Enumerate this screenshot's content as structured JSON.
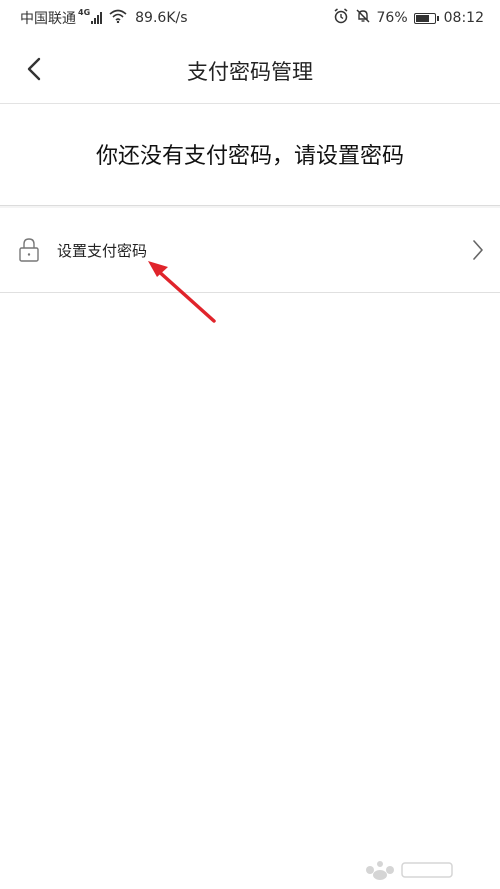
{
  "status_bar": {
    "carrier": "中国联通",
    "network_type": "4G",
    "speed": "89.6K/s",
    "battery_percent": "76%",
    "battery_level": 0.76,
    "time": "08:12",
    "icons": [
      "signal-icon",
      "wifi-icon",
      "alarm-icon",
      "mute-bell-icon",
      "battery-icon"
    ]
  },
  "header": {
    "title": "支付密码管理",
    "back_icon": "chevron-left-icon"
  },
  "notice": {
    "text": "你还没有支付密码，请设置密码"
  },
  "menu": {
    "items": [
      {
        "label": "设置支付密码",
        "icon": "lock-icon",
        "trailing_icon": "chevron-right-icon"
      }
    ]
  },
  "annotation": {
    "arrow_color": "#e0242b"
  },
  "colors": {
    "background": "#ffffff",
    "divider": "#e0e0e0",
    "text_primary": "#222222",
    "icon_gray": "#666666"
  }
}
